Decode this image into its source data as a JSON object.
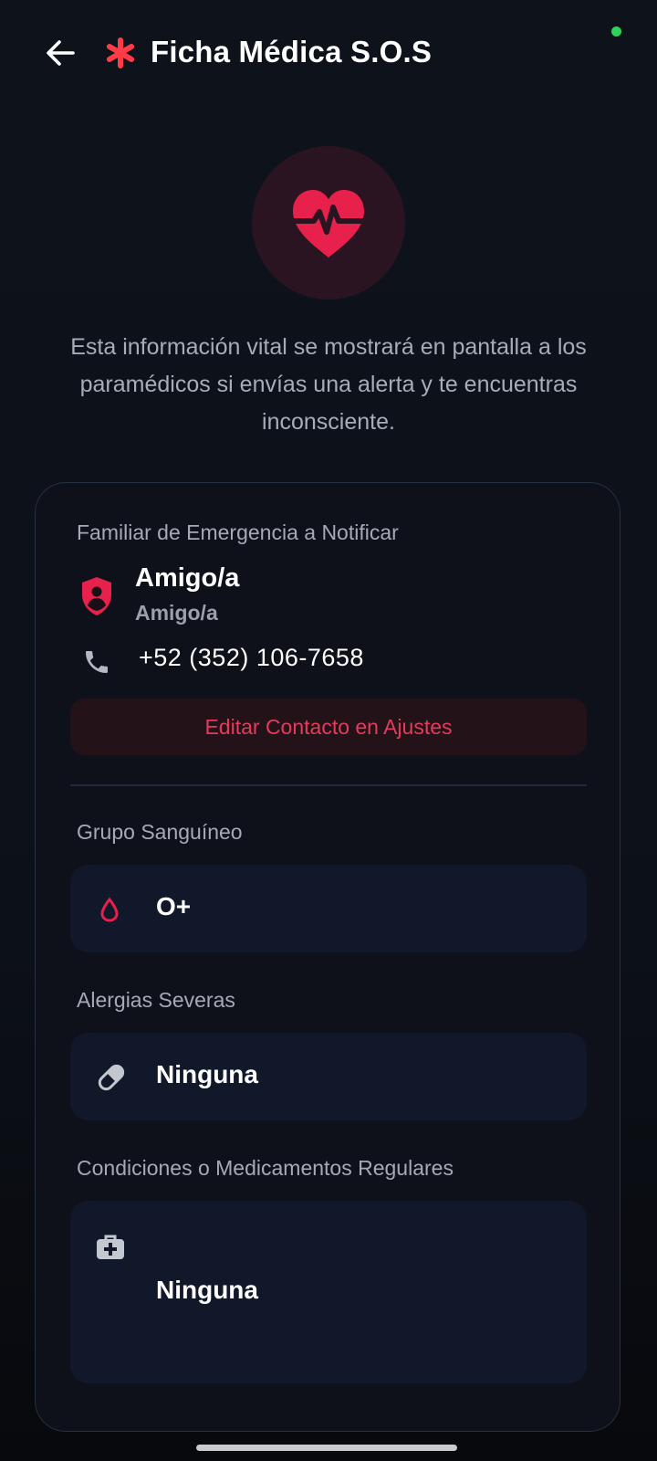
{
  "header": {
    "title": "Ficha Médica S.O.S"
  },
  "intro": {
    "text": "Esta información vital se mostrará en pantalla a los paramédicos si envías una alerta y te encuentras inconsciente."
  },
  "contact": {
    "section_label": "Familiar de Emergencia a Notificar",
    "name": "Amigo/a",
    "relation": "Amigo/a",
    "phone": "+52 (352) 106-7658",
    "edit_button": "Editar Contacto en Ajustes"
  },
  "blood": {
    "label": "Grupo Sanguíneo",
    "value": "O+"
  },
  "allergies": {
    "label": "Alergias Severas",
    "value": "Ninguna"
  },
  "conditions": {
    "label": "Condiciones o Medicamentos Regulares",
    "value": "Ninguna"
  },
  "colors": {
    "accent": "#e8204c",
    "background": "#0d121b",
    "card": "#0e1119",
    "status_online": "#2fd159"
  },
  "icons": {
    "back": "arrow-left-icon",
    "title": "asterisk-icon",
    "hero": "heart-pulse-icon",
    "contact": "shield-person-icon",
    "phone": "phone-icon",
    "blood": "droplet-icon",
    "allergies": "pill-icon",
    "conditions": "medical-kit-icon"
  }
}
